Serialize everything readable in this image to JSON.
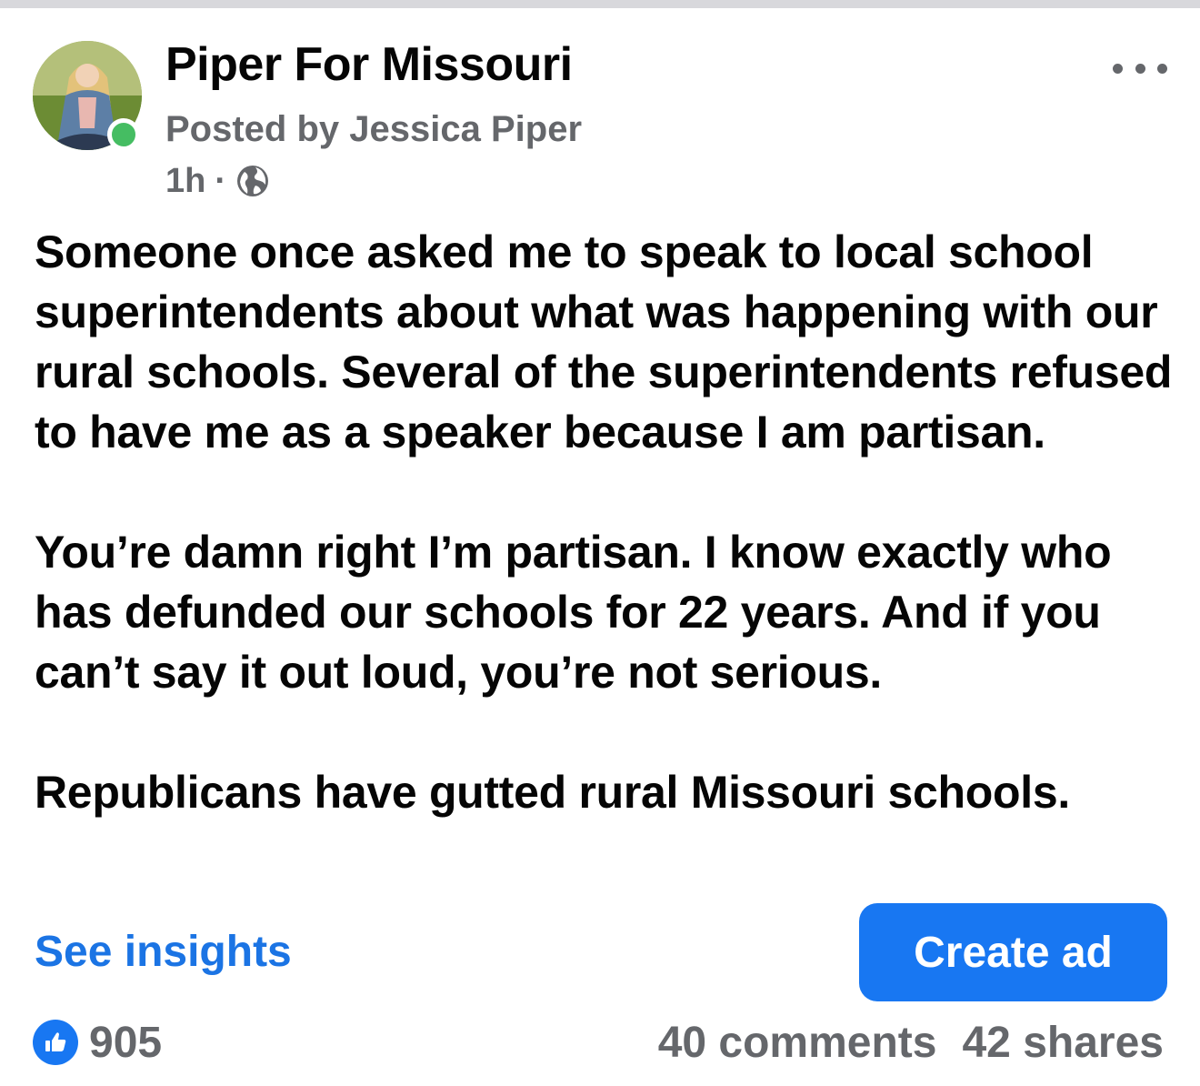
{
  "post": {
    "page_name": "Piper For Missouri",
    "posted_by": "Posted by Jessica Piper",
    "time": "1h",
    "separator": "·",
    "audience_icon": "globe-icon",
    "paragraphs": [
      "Someone once asked me to speak to local school superintendents about what was happening with our rural schools. Several of the superintendents refused to have me as a speaker because I am partisan.",
      "You’re damn right I’m partisan. I know exactly who has defunded our schools for 22 years. And if you can’t say it out loud, you’re not serious.",
      "Republicans have gutted rural Missouri schools."
    ]
  },
  "actions": {
    "see_insights": "See insights",
    "create_ad": "Create ad"
  },
  "engagement": {
    "reaction_icon": "like-icon",
    "reactions": "905",
    "comments": "40 comments",
    "shares": "42 shares"
  },
  "colors": {
    "link_blue": "#1b74e4",
    "button_blue": "#1877f2",
    "secondary_text": "#65676b",
    "online_green": "#45bd62"
  }
}
